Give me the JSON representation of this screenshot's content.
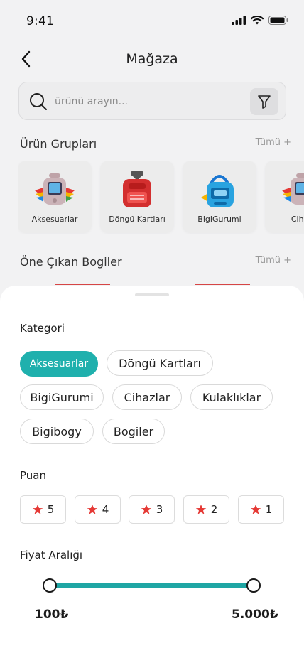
{
  "status": {
    "time": "9:41"
  },
  "header": {
    "title": "Mağaza"
  },
  "search": {
    "placeholder": "ürünü arayın..."
  },
  "groups_section": {
    "title": "Ürün Grupları",
    "see_all": "Tümü +",
    "items": [
      {
        "label": "Aksesuarlar",
        "icon": "device-with-wings"
      },
      {
        "label": "Döngü Kartları",
        "icon": "red-speaker"
      },
      {
        "label": "BigiGurumi",
        "icon": "blue-speaker"
      },
      {
        "label": "Cihaz",
        "icon": "device-with-wings"
      }
    ]
  },
  "featured_section": {
    "title": "Öne Çıkan Bogiler",
    "see_all": "Tümü +"
  },
  "filter_sheet": {
    "category": {
      "title": "Kategori",
      "options": [
        "Aksesuarlar",
        "Döngü Kartları",
        "BigiGurumi",
        "Cihazlar",
        "Kulaklıklar",
        "Bigibogy",
        "Bogiler"
      ],
      "selected": "Aksesuarlar"
    },
    "rating": {
      "title": "Puan",
      "options": [
        "5",
        "4",
        "3",
        "2",
        "1"
      ]
    },
    "price": {
      "title": "Fiyat Aralığı",
      "min": "100₺",
      "max": "5.000₺"
    }
  },
  "colors": {
    "accent": "#1fb0ad",
    "star": "#e53935",
    "background": "#f2f2f3"
  }
}
